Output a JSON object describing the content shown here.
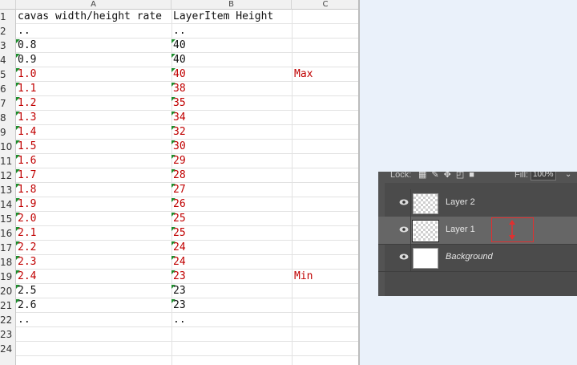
{
  "spreadsheet": {
    "columns": [
      "A",
      "B",
      "C"
    ],
    "row_numbers": [
      "1",
      "2",
      "3",
      "4",
      "5",
      "6",
      "7",
      "8",
      "9",
      "10",
      "11",
      "12",
      "13",
      "14",
      "15",
      "16",
      "17",
      "18",
      "19",
      "20",
      "21",
      "22",
      "23",
      "24"
    ],
    "colors": {
      "red_text": "#c00000",
      "normal_text": "#111111",
      "comment_marker": "#1c8c2c"
    },
    "rows": [
      {
        "a": "cavas width/height rate",
        "b": "LayerItem Height",
        "c": "",
        "red": false,
        "marker": false
      },
      {
        "a": "..",
        "b": "..",
        "c": "",
        "red": false,
        "marker": false
      },
      {
        "a": "0.8",
        "b": "40",
        "c": "",
        "red": false,
        "marker": true
      },
      {
        "a": "0.9",
        "b": "40",
        "c": "",
        "red": false,
        "marker": true
      },
      {
        "a": "1.0",
        "b": "40",
        "c": "Max",
        "red": true,
        "marker": true
      },
      {
        "a": "1.1",
        "b": "38",
        "c": "",
        "red": true,
        "marker": true
      },
      {
        "a": "1.2",
        "b": "35",
        "c": "",
        "red": true,
        "marker": true
      },
      {
        "a": "1.3",
        "b": "34",
        "c": "",
        "red": true,
        "marker": true
      },
      {
        "a": "1.4",
        "b": "32",
        "c": "",
        "red": true,
        "marker": true
      },
      {
        "a": "1.5",
        "b": "30",
        "c": "",
        "red": true,
        "marker": true
      },
      {
        "a": "1.6",
        "b": "29",
        "c": "",
        "red": true,
        "marker": true
      },
      {
        "a": "1.7",
        "b": "28",
        "c": "",
        "red": true,
        "marker": true
      },
      {
        "a": "1.8",
        "b": "27",
        "c": "",
        "red": true,
        "marker": true
      },
      {
        "a": "1.9",
        "b": "26",
        "c": "",
        "red": true,
        "marker": true
      },
      {
        "a": "2.0",
        "b": "25",
        "c": "",
        "red": true,
        "marker": true
      },
      {
        "a": "2.1",
        "b": "25",
        "c": "",
        "red": true,
        "marker": true
      },
      {
        "a": "2.2",
        "b": "24",
        "c": "",
        "red": true,
        "marker": true
      },
      {
        "a": "2.3",
        "b": "24",
        "c": "",
        "red": true,
        "marker": true
      },
      {
        "a": "2.4",
        "b": "23",
        "c": "Min",
        "red": true,
        "marker": true
      },
      {
        "a": "2.5",
        "b": "23",
        "c": "",
        "red": false,
        "marker": true
      },
      {
        "a": "2.6",
        "b": "23",
        "c": "",
        "red": false,
        "marker": true
      },
      {
        "a": "..",
        "b": "..",
        "c": "",
        "red": false,
        "marker": false
      },
      {
        "a": "",
        "b": "",
        "c": "",
        "red": false,
        "marker": false
      },
      {
        "a": "",
        "b": "",
        "c": "",
        "red": false,
        "marker": false
      }
    ]
  },
  "layers_panel": {
    "lock_label": "Lock:",
    "fill_label": "Fill:",
    "fill_value": "100%",
    "lock_icons": [
      "lock-transparent-icon",
      "lock-paint-icon",
      "lock-move-icon",
      "lock-artboard-icon",
      "lock-all-icon"
    ],
    "layers": [
      {
        "name": "Layer 2",
        "thumbnail": "transparent",
        "selected": false,
        "italic": false
      },
      {
        "name": "Layer 1",
        "thumbnail": "transparent",
        "selected": true,
        "italic": false
      },
      {
        "name": "Background",
        "thumbnail": "white",
        "selected": false,
        "italic": true
      }
    ],
    "colors": {
      "panel_bg": "#535353",
      "selected_row": "#666666",
      "annotation_red": "#e03030"
    }
  }
}
